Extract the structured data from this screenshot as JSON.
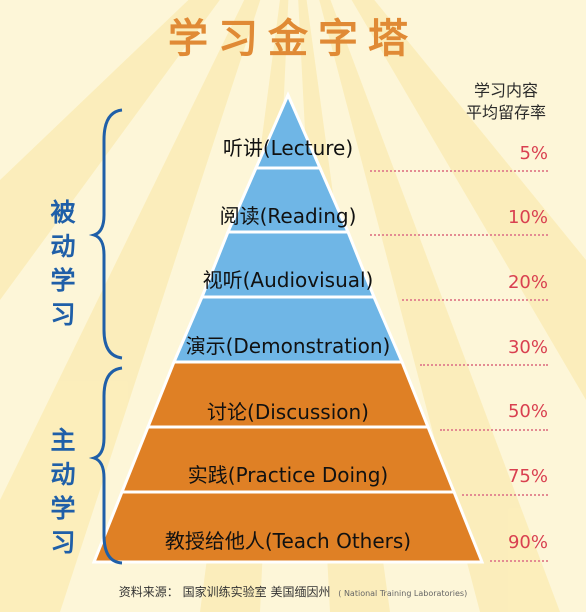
{
  "title": "学习金字塔",
  "column_header": {
    "line1": "学习内容",
    "line2": "平均留存率"
  },
  "groups": {
    "passive": {
      "line1": "被动",
      "line2": "学习"
    },
    "active": {
      "line1": "主动",
      "line2": "学习"
    }
  },
  "levels": [
    {
      "label": "听讲(Lecture)",
      "retention": "5%",
      "color": "#6fb6e6"
    },
    {
      "label": "阅读(Reading)",
      "retention": "10%",
      "color": "#6fb6e6"
    },
    {
      "label": "视听(Audiovisual)",
      "retention": "20%",
      "color": "#6fb6e6"
    },
    {
      "label": "演示(Demonstration)",
      "retention": "30%",
      "color": "#6fb6e6"
    },
    {
      "label": "讨论(Discussion)",
      "retention": "50%",
      "color": "#df8025"
    },
    {
      "label": "实践(Practice Doing)",
      "retention": "75%",
      "color": "#df8025"
    },
    {
      "label": "教授给他人(Teach Others)",
      "retention": "90%",
      "color": "#df8025"
    }
  ],
  "source": {
    "prefix": "资料来源：",
    "text": "国家训练实验室  美国缅因州",
    "english": "( National Training Laboratories)"
  },
  "colors": {
    "title": "#e08a35",
    "group_label": "#1f5fa8",
    "retention": "#d94050",
    "passive": "#6fb6e6",
    "active": "#df8025"
  }
}
